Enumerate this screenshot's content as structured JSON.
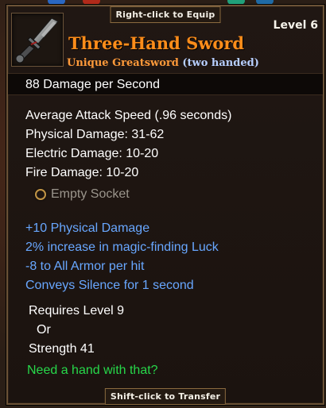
{
  "hints": {
    "top": "Right-click to Equip",
    "bottom": "Shift-click to Transfer"
  },
  "item": {
    "name": "Three-Hand Sword",
    "rarity_type": "Unique Greatsword",
    "handedness": "(two handed)",
    "level_label": "Level 6",
    "icon": "greatsword-icon",
    "dps_label": "88  Damage per Second"
  },
  "stats": [
    "Average Attack Speed (.96 seconds)",
    "Physical Damage: 31-62",
    "Electric Damage: 10-20",
    "Fire Damage: 10-20"
  ],
  "socket": {
    "label": "Empty Socket",
    "icon": "socket-ring-icon"
  },
  "modifiers": [
    "+10 Physical Damage",
    "2% increase in magic-finding Luck",
    "-8 to All Armor per hit",
    "Conveys Silence for 1 second"
  ],
  "requirements": {
    "line1": "Requires Level 9",
    "or": "Or",
    "line2": "Strength 41"
  },
  "flavor_text": "Need a hand with that?",
  "colors": {
    "title": "#ff8d1a",
    "subtitle": "#ff9a3a",
    "handedness": "#b7cfff",
    "modifiers": "#68a7ff",
    "flavor": "#27d84a",
    "socket_text": "#9b958c",
    "border": "#6b5236"
  }
}
